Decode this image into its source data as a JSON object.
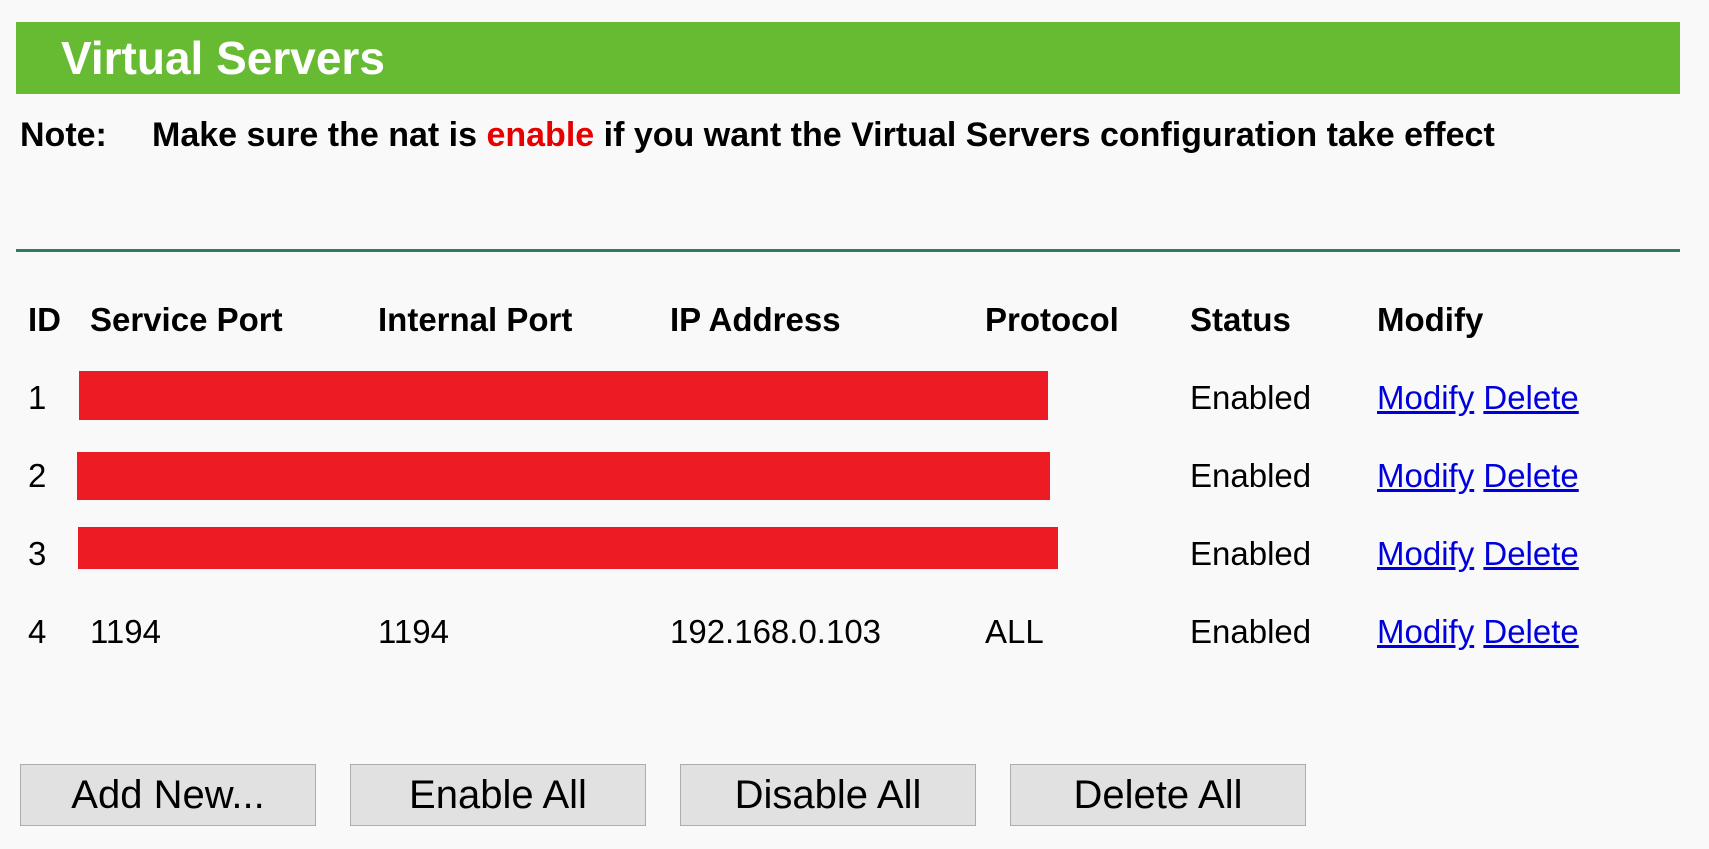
{
  "title": "Virtual Servers",
  "note": {
    "label": "Note:",
    "text_before": "Make sure the nat is ",
    "highlight": "enable",
    "text_after": " if you want the Virtual Servers configuration take effect",
    "highlight_color": "#e60000"
  },
  "table": {
    "headers": {
      "id": "ID",
      "service_port": "Service Port",
      "internal_port": "Internal Port",
      "ip_address": "IP Address",
      "protocol": "Protocol",
      "status": "Status",
      "modify": "Modify"
    },
    "rows": [
      {
        "id": "1",
        "service_port": "",
        "internal_port": "",
        "ip_address": "",
        "protocol": "",
        "status": "Enabled",
        "modify_label": "Modify",
        "delete_label": "Delete",
        "redacted": true
      },
      {
        "id": "2",
        "service_port": "",
        "internal_port": "",
        "ip_address": "",
        "protocol": "",
        "status": "Enabled",
        "modify_label": "Modify",
        "delete_label": "Delete",
        "redacted": true
      },
      {
        "id": "3",
        "service_port": "",
        "internal_port": "",
        "ip_address": "",
        "protocol": "",
        "status": "Enabled",
        "modify_label": "Modify",
        "delete_label": "Delete",
        "redacted": true
      },
      {
        "id": "4",
        "service_port": "1194",
        "internal_port": "1194",
        "ip_address": "192.168.0.103",
        "protocol": "ALL",
        "status": "Enabled",
        "modify_label": "Modify",
        "delete_label": "Delete",
        "redacted": false
      }
    ]
  },
  "buttons": {
    "add_new": "Add New...",
    "enable_all": "Enable All",
    "disable_all": "Disable All",
    "delete_all": "Delete All"
  },
  "colors": {
    "header_bg": "#66bb33",
    "redaction": "#ed1c24",
    "link": "#0000dd"
  }
}
